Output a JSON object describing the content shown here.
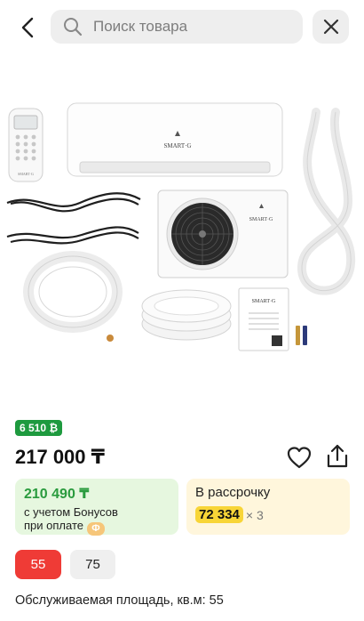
{
  "header": {
    "search_placeholder": "Поиск товара"
  },
  "product": {
    "brand_indoor": "SMART·G",
    "brand_outdoor": "SMART·G",
    "brand_remote": "SMART·G",
    "brand_manual": "SMART·G"
  },
  "bonus_badge": "6 510 ₿",
  "price": "217 000 ₸",
  "offers": {
    "bonus": {
      "amount": "210 490 ₸",
      "line1": "с учетом Бонусов",
      "line2": "при оплате",
      "coin": "Ф"
    },
    "installment": {
      "title": "В рассрочку",
      "amount": "72 334",
      "multiplier": "× 3"
    }
  },
  "area_options": {
    "selected": "55",
    "options": [
      "55",
      "75"
    ]
  },
  "area_label": "Обслуживаемая площадь, кв.м: 55",
  "colors": {
    "accent_red": "#ef3b36",
    "bonus_green": "#1e9a3f",
    "installment_yellow": "#f8d537"
  }
}
